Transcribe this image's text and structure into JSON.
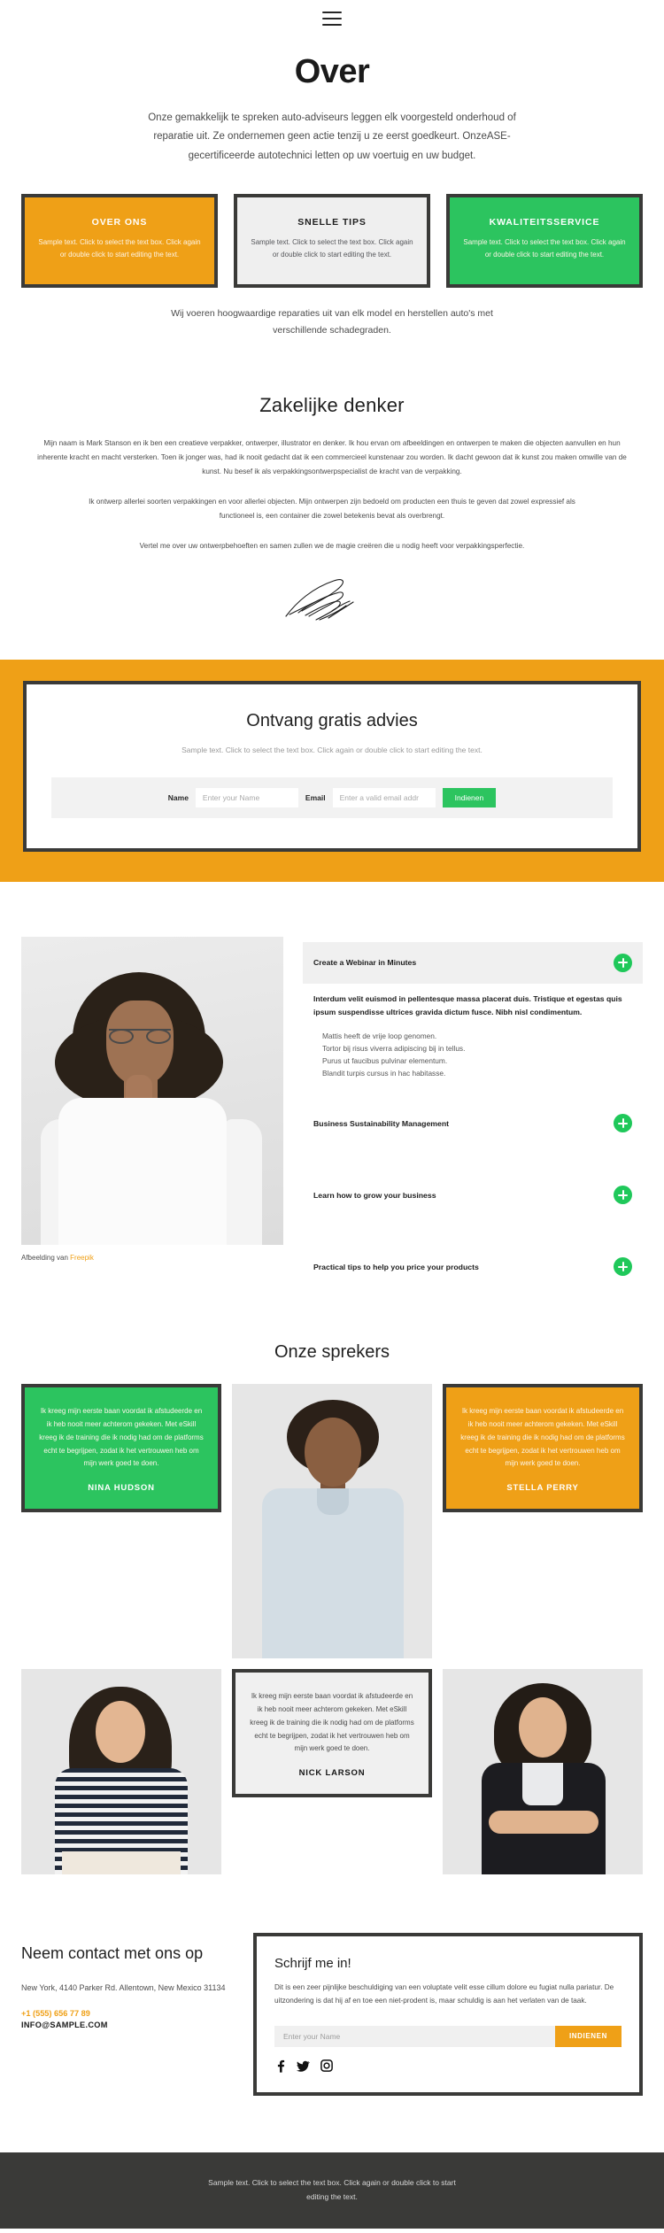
{
  "header": {
    "menu_icon": "hamburger-icon"
  },
  "hero": {
    "title": "Over",
    "paragraph": "Onze gemakkelijk te spreken auto-adviseurs leggen elk voorgesteld onderhoud of reparatie uit. Ze ondernemen geen actie tenzij u ze eerst goedkeurt. OnzeASE-gecertificeerde autotechnici letten op uw voertuig en uw budget."
  },
  "feature_cards": [
    {
      "title": "OVER ONS",
      "text": "Sample text. Click to select the text box. Click again or double click to start editing the text.",
      "color": "#efa017",
      "style": "orange"
    },
    {
      "title": "SNELLE TIPS",
      "text": "Sample text. Click to select the text box. Click again or double click to start editing the text.",
      "color": "#efefef",
      "style": "grey"
    },
    {
      "title": "KWALITEITSSERVICE",
      "text": "Sample text. Click to select the text box. Click again or double click to start editing the text.",
      "color": "#2cc45f",
      "style": "green"
    }
  ],
  "cards_note": "Wij voeren hoogwaardige reparaties uit van elk model en herstellen auto's met verschillende schadegraden.",
  "thinker": {
    "title": "Zakelijke denker",
    "p1": "Mijn naam is Mark Stanson en ik ben een creatieve verpakker, ontwerper, illustrator en denker. Ik hou ervan om afbeeldingen en ontwerpen te maken die objecten aanvullen en hun inherente kracht en macht versterken. Toen ik jonger was, had ik nooit gedacht dat ik een commercieel kunstenaar zou worden. Ik dacht gewoon dat ik kunst zou maken omwille van de kunst. Nu besef ik als verpakkingsontwerpspecialist de kracht van de verpakking.",
    "p2": "Ik ontwerp allerlei soorten verpakkingen en voor allerlei objecten. Mijn ontwerpen zijn bedoeld om producten een thuis te geven dat zowel expressief als functioneel is, een container die zowel betekenis bevat als overbrengt.",
    "p3": "Vertel me over uw ontwerpbehoeften en samen zullen we de magie creëren die u nodig heeft voor verpakkingsperfectie.",
    "signature_alt": "signature"
  },
  "advice": {
    "title": "Ontvang gratis advies",
    "subtitle": "Sample text. Click to select the text box. Click again or double click to start editing the text.",
    "name_label": "Name",
    "name_placeholder": "Enter your Name",
    "email_label": "Email",
    "email_placeholder": "Enter a valid email addr",
    "submit_label": "Indienen",
    "band_color": "#efa017",
    "button_color": "#2cc45f"
  },
  "accordion": {
    "image_credit_prefix": "Afbeelding van ",
    "image_credit_link": "Freepik",
    "items": [
      {
        "title": "Create a Webinar in Minutes",
        "open": true,
        "lead": "Interdum velit euismod in pellentesque massa placerat duis. Tristique et egestas quis ipsum suspendisse ultrices gravida dictum fusce. Nibh nisl condimentum.",
        "bullets": [
          "Mattis heeft de vrije loop genomen.",
          "Tortor bij risus viverra adipiscing bij in tellus.",
          "Purus ut faucibus pulvinar elementum.",
          "Blandit turpis cursus in hac habitasse."
        ]
      },
      {
        "title": "Business Sustainability Management",
        "open": false
      },
      {
        "title": "Learn how to grow your business",
        "open": false
      },
      {
        "title": "Practical tips to help you price your products",
        "open": false
      }
    ]
  },
  "speakers": {
    "title": "Onze sprekers",
    "quote_text": "Ik kreeg mijn eerste baan voordat ik afstudeerde en ik heb nooit meer achterom gekeken. Met eSkill kreeg ik de training die ik nodig had om de platforms echt te begrijpen, zodat ik het vertrouwen heb om mijn werk goed te doen.",
    "names": {
      "green": "NINA HUDSON",
      "orange": "STELLA PERRY",
      "light": "NICK LARSON"
    }
  },
  "contact": {
    "title": "Neem contact met ons op",
    "address": "New York, 4140 Parker Rd. Allentown, New Mexico 31134",
    "phone": "+1 (555) 656 77 89",
    "email": "INFO@SAMPLE.COM",
    "form_title": "Schrijf me in!",
    "form_text": "Dit is een zeer pijnlijke beschuldiging van een voluptate velit esse cillum dolore eu fugiat nulla pariatur. De uitzondering is dat hij af en toe een niet-prodent is, maar schuldig is aan het verlaten van de taak.",
    "name_placeholder": "Enter your Name",
    "submit_label": "INDIENEN",
    "socials": [
      "facebook-icon",
      "twitter-icon",
      "instagram-icon"
    ]
  },
  "footer": {
    "text": "Sample text. Click to select the text box. Click again or double click to start editing the text."
  }
}
